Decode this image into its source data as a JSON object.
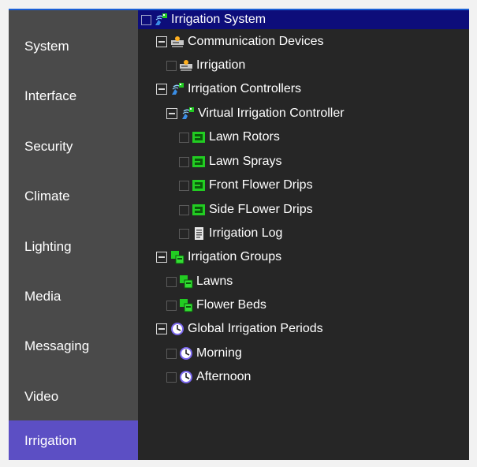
{
  "sidebar": {
    "items": [
      {
        "label": "System"
      },
      {
        "label": "Interface"
      },
      {
        "label": "Security"
      },
      {
        "label": "Climate"
      },
      {
        "label": "Lighting"
      },
      {
        "label": "Media"
      },
      {
        "label": "Messaging"
      },
      {
        "label": "Video"
      },
      {
        "label": "Irrigation"
      }
    ],
    "active": "Irrigation"
  },
  "tree": {
    "root": "Irrigation System",
    "communication_devices": "Communication Devices",
    "comm_irrigation": "Irrigation",
    "controllers": "Irrigation Controllers",
    "virtual_controller": "Virtual Irrigation Controller",
    "zones": [
      "Lawn Rotors",
      "Lawn Sprays",
      "Front Flower Drips",
      "Side FLower Drips"
    ],
    "log": "Irrigation Log",
    "groups": "Irrigation Groups",
    "group_items": [
      "Lawns",
      "Flower Beds"
    ],
    "periods": "Global Irrigation Periods",
    "period_items": [
      "Morning",
      "Afternoon"
    ]
  },
  "colors": {
    "sidebar_bg": "#4a4a4a",
    "active_bg": "#5c4fc4",
    "tree_bg": "#262626",
    "selection": "#0d0d7a",
    "zone_icon": "#22cc22",
    "clock_icon": "#7b68ee"
  },
  "icons": {
    "root": "sprinkler-icon",
    "comm": "network-device-icon",
    "zone": "valve-icon",
    "log": "log-document-icon",
    "group": "group-icon",
    "period": "clock-icon"
  }
}
